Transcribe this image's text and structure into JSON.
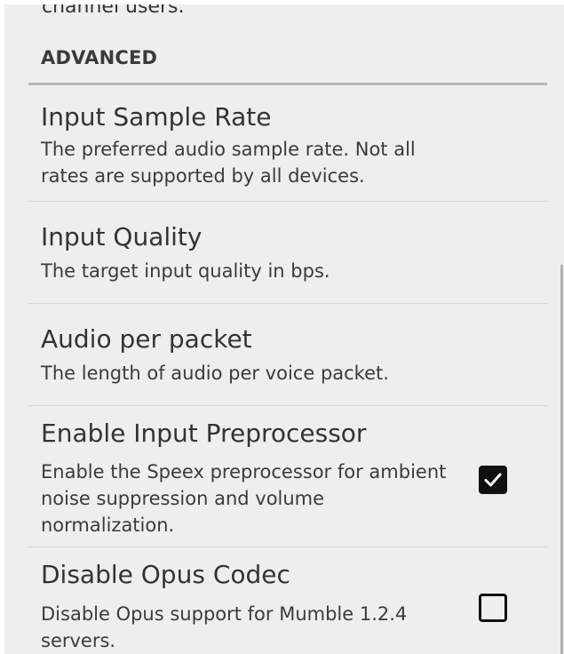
{
  "top_snippet": "channel users.",
  "section": {
    "title": "ADVANCED"
  },
  "prefs": [
    {
      "title": "Input Sample Rate",
      "summary": "The preferred audio sample rate. Not all rates are supported by all devices."
    },
    {
      "title": "Input Quality",
      "summary": "The target input quality in bps."
    },
    {
      "title": "Audio per packet",
      "summary": "The length of audio per voice packet."
    },
    {
      "title": "Enable Input Preprocessor",
      "summary": "Enable the Speex preprocessor for ambient noise suppression and volume normalization.",
      "checked": true
    },
    {
      "title": "Disable Opus Codec",
      "summary": "Disable Opus support for Mumble 1.2.4 servers.",
      "checked": false
    }
  ],
  "icons": {
    "check": "check-icon"
  },
  "colors": {
    "background": "#eeeeee",
    "text": "#333333",
    "checkbox": "#111111"
  }
}
